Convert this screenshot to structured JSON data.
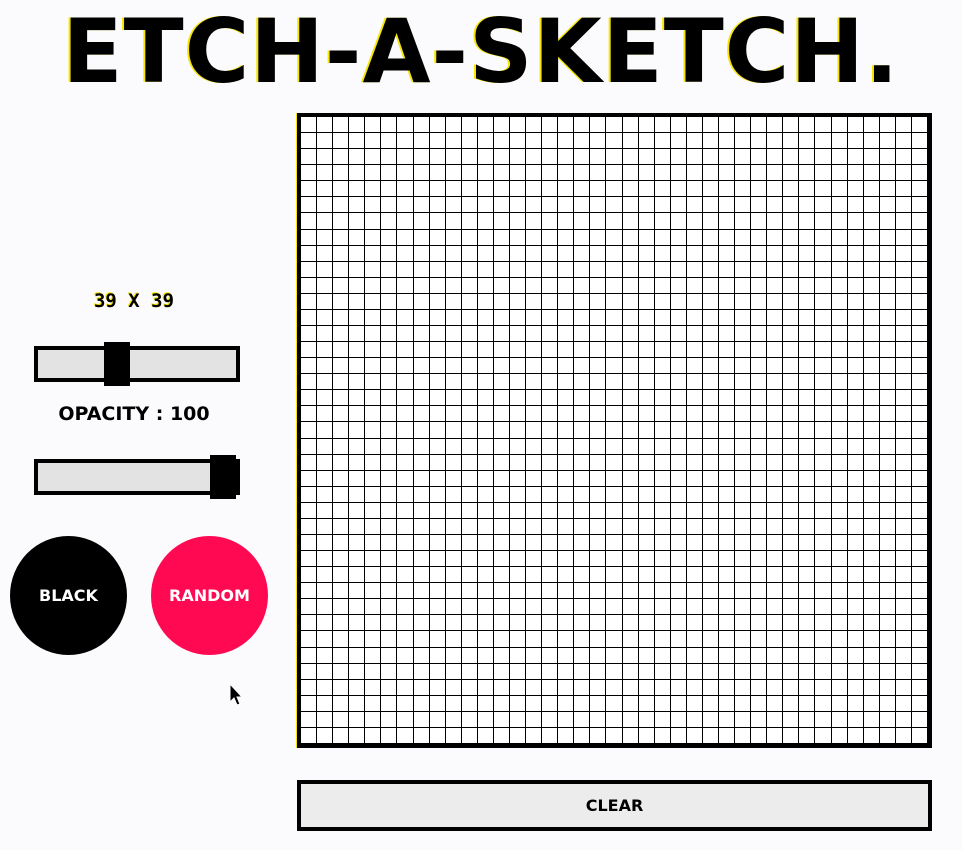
{
  "header": {
    "title": "ETCH-A-SKETCH."
  },
  "controls": {
    "grid_size_label": "39 X 39",
    "grid_size": 39,
    "grid_size_min": 1,
    "grid_size_max": 100,
    "opacity_label": "OPACITY : 100",
    "opacity_value": 100,
    "opacity_min": 0,
    "opacity_max": 100
  },
  "buttons": {
    "black_label": "BLACK",
    "random_label": "RANDOM",
    "clear_label": "CLEAR"
  },
  "colors": {
    "black_button": "#000000",
    "random_button": "#ff0a52",
    "title_shadow": "#f6e600",
    "slider_track": "#e3e3e3"
  },
  "icons": {
    "cursor": "mouse-pointer-icon"
  }
}
